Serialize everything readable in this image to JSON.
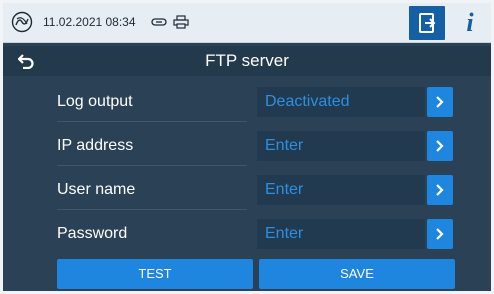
{
  "status_bar": {
    "datetime": "11.02.2021 08:34",
    "icons": [
      "device-logo-icon",
      "card-icon",
      "printer-icon",
      "logout-icon",
      "info-icon"
    ],
    "info_label": "i"
  },
  "header": {
    "title": "FTP server"
  },
  "rows": [
    {
      "label": "Log output",
      "value": "Deactivated"
    },
    {
      "label": "IP address",
      "value": "Enter"
    },
    {
      "label": "User name",
      "value": "Enter"
    },
    {
      "label": "Password",
      "value": "Enter"
    }
  ],
  "actions": {
    "test_label": "TEST",
    "save_label": "SAVE"
  },
  "colors": {
    "background": "#2b4256",
    "accent": "#1f86e0",
    "field_text": "#2d8fe0",
    "status_bar": "#e6eef4"
  }
}
